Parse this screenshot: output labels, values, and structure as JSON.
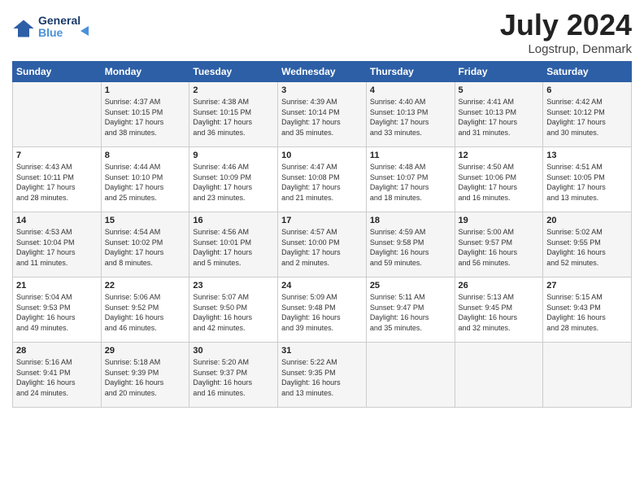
{
  "header": {
    "logo_line1": "General",
    "logo_line2": "Blue",
    "title": "July 2024",
    "location": "Logstrup, Denmark"
  },
  "days_of_week": [
    "Sunday",
    "Monday",
    "Tuesday",
    "Wednesday",
    "Thursday",
    "Friday",
    "Saturday"
  ],
  "weeks": [
    [
      {
        "day": "",
        "info": ""
      },
      {
        "day": "1",
        "info": "Sunrise: 4:37 AM\nSunset: 10:15 PM\nDaylight: 17 hours\nand 38 minutes."
      },
      {
        "day": "2",
        "info": "Sunrise: 4:38 AM\nSunset: 10:15 PM\nDaylight: 17 hours\nand 36 minutes."
      },
      {
        "day": "3",
        "info": "Sunrise: 4:39 AM\nSunset: 10:14 PM\nDaylight: 17 hours\nand 35 minutes."
      },
      {
        "day": "4",
        "info": "Sunrise: 4:40 AM\nSunset: 10:13 PM\nDaylight: 17 hours\nand 33 minutes."
      },
      {
        "day": "5",
        "info": "Sunrise: 4:41 AM\nSunset: 10:13 PM\nDaylight: 17 hours\nand 31 minutes."
      },
      {
        "day": "6",
        "info": "Sunrise: 4:42 AM\nSunset: 10:12 PM\nDaylight: 17 hours\nand 30 minutes."
      }
    ],
    [
      {
        "day": "7",
        "info": "Sunrise: 4:43 AM\nSunset: 10:11 PM\nDaylight: 17 hours\nand 28 minutes."
      },
      {
        "day": "8",
        "info": "Sunrise: 4:44 AM\nSunset: 10:10 PM\nDaylight: 17 hours\nand 25 minutes."
      },
      {
        "day": "9",
        "info": "Sunrise: 4:46 AM\nSunset: 10:09 PM\nDaylight: 17 hours\nand 23 minutes."
      },
      {
        "day": "10",
        "info": "Sunrise: 4:47 AM\nSunset: 10:08 PM\nDaylight: 17 hours\nand 21 minutes."
      },
      {
        "day": "11",
        "info": "Sunrise: 4:48 AM\nSunset: 10:07 PM\nDaylight: 17 hours\nand 18 minutes."
      },
      {
        "day": "12",
        "info": "Sunrise: 4:50 AM\nSunset: 10:06 PM\nDaylight: 17 hours\nand 16 minutes."
      },
      {
        "day": "13",
        "info": "Sunrise: 4:51 AM\nSunset: 10:05 PM\nDaylight: 17 hours\nand 13 minutes."
      }
    ],
    [
      {
        "day": "14",
        "info": "Sunrise: 4:53 AM\nSunset: 10:04 PM\nDaylight: 17 hours\nand 11 minutes."
      },
      {
        "day": "15",
        "info": "Sunrise: 4:54 AM\nSunset: 10:02 PM\nDaylight: 17 hours\nand 8 minutes."
      },
      {
        "day": "16",
        "info": "Sunrise: 4:56 AM\nSunset: 10:01 PM\nDaylight: 17 hours\nand 5 minutes."
      },
      {
        "day": "17",
        "info": "Sunrise: 4:57 AM\nSunset: 10:00 PM\nDaylight: 17 hours\nand 2 minutes."
      },
      {
        "day": "18",
        "info": "Sunrise: 4:59 AM\nSunset: 9:58 PM\nDaylight: 16 hours\nand 59 minutes."
      },
      {
        "day": "19",
        "info": "Sunrise: 5:00 AM\nSunset: 9:57 PM\nDaylight: 16 hours\nand 56 minutes."
      },
      {
        "day": "20",
        "info": "Sunrise: 5:02 AM\nSunset: 9:55 PM\nDaylight: 16 hours\nand 52 minutes."
      }
    ],
    [
      {
        "day": "21",
        "info": "Sunrise: 5:04 AM\nSunset: 9:53 PM\nDaylight: 16 hours\nand 49 minutes."
      },
      {
        "day": "22",
        "info": "Sunrise: 5:06 AM\nSunset: 9:52 PM\nDaylight: 16 hours\nand 46 minutes."
      },
      {
        "day": "23",
        "info": "Sunrise: 5:07 AM\nSunset: 9:50 PM\nDaylight: 16 hours\nand 42 minutes."
      },
      {
        "day": "24",
        "info": "Sunrise: 5:09 AM\nSunset: 9:48 PM\nDaylight: 16 hours\nand 39 minutes."
      },
      {
        "day": "25",
        "info": "Sunrise: 5:11 AM\nSunset: 9:47 PM\nDaylight: 16 hours\nand 35 minutes."
      },
      {
        "day": "26",
        "info": "Sunrise: 5:13 AM\nSunset: 9:45 PM\nDaylight: 16 hours\nand 32 minutes."
      },
      {
        "day": "27",
        "info": "Sunrise: 5:15 AM\nSunset: 9:43 PM\nDaylight: 16 hours\nand 28 minutes."
      }
    ],
    [
      {
        "day": "28",
        "info": "Sunrise: 5:16 AM\nSunset: 9:41 PM\nDaylight: 16 hours\nand 24 minutes."
      },
      {
        "day": "29",
        "info": "Sunrise: 5:18 AM\nSunset: 9:39 PM\nDaylight: 16 hours\nand 20 minutes."
      },
      {
        "day": "30",
        "info": "Sunrise: 5:20 AM\nSunset: 9:37 PM\nDaylight: 16 hours\nand 16 minutes."
      },
      {
        "day": "31",
        "info": "Sunrise: 5:22 AM\nSunset: 9:35 PM\nDaylight: 16 hours\nand 13 minutes."
      },
      {
        "day": "",
        "info": ""
      },
      {
        "day": "",
        "info": ""
      },
      {
        "day": "",
        "info": ""
      }
    ]
  ]
}
